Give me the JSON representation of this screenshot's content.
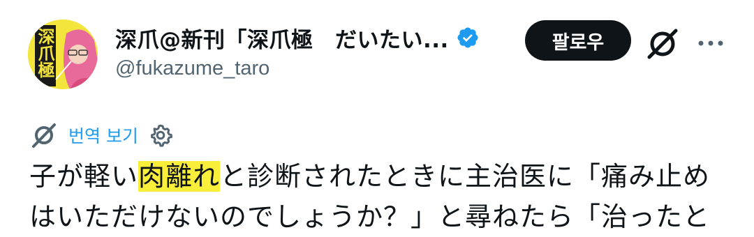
{
  "author": {
    "display_name": "深爪@新刊「深爪極　だいたい...",
    "handle": "@fukazume_taro",
    "verified": true,
    "avatar_text": "深爪極"
  },
  "actions": {
    "follow_label": "팔로우",
    "grok_icon": "grok-icon",
    "more_icon": "more-horizontal-icon"
  },
  "translate": {
    "label": "번역 보기",
    "icon": "translate-icon",
    "settings_icon": "gear-icon"
  },
  "tweet": {
    "line1_pre": "子が軽い",
    "line1_highlight": "肉離れ",
    "line1_post": "と診断されたときに主治医に「痛み止め",
    "line2": "はいただけないのでしょうか？」と尋ねたら「治ったと"
  },
  "colors": {
    "accent": "#1d9bf0",
    "follow_button_bg": "#0f1419",
    "highlight": "#f9ee3a",
    "secondary_text": "#536471"
  }
}
